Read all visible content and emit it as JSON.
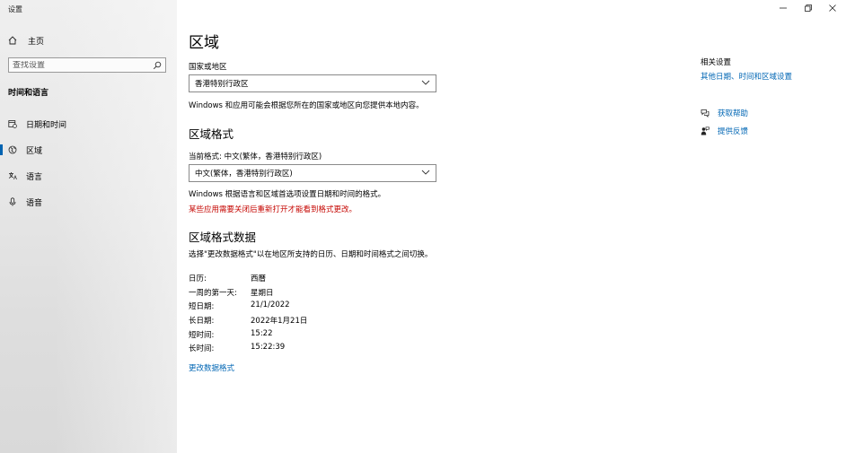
{
  "window": {
    "title": "设置",
    "controls": {
      "minimize": "—",
      "maximize": "⧉",
      "close": "✕"
    }
  },
  "sidebar": {
    "home_label": "主页",
    "search_placeholder": "查找设置",
    "section_label": "时间和语言",
    "items": [
      {
        "label": "日期和时间",
        "icon": "calendar-clock-icon",
        "active": false
      },
      {
        "label": "区域",
        "icon": "globe-region-icon",
        "active": true
      },
      {
        "label": "语言",
        "icon": "language-icon",
        "active": false
      },
      {
        "label": "语音",
        "icon": "microphone-icon",
        "active": false
      }
    ]
  },
  "main": {
    "title": "区域",
    "country": {
      "label": "国家或地区",
      "value": "香港特别行政区",
      "description": "Windows 和应用可能会根据您所在的国家或地区向您提供本地内容。"
    },
    "format": {
      "heading": "区域格式",
      "current_label": "当前格式: 中文(繁体，香港特别行政区)",
      "value": "中文(繁体，香港特别行政区)",
      "description": "Windows 根据语言和区域首选项设置日期和时间的格式。",
      "warning": "某些应用需要关闭后重新打开才能看到格式更改。"
    },
    "data": {
      "heading": "区域格式数据",
      "description": "选择\"更改数据格式\"以在地区所支持的日历、日期和时间格式之间切换。",
      "rows": [
        {
          "key": "日历:",
          "value": "西曆"
        },
        {
          "key": "一周的第一天:",
          "value": "星期日"
        },
        {
          "key": "短日期:",
          "value": "21/1/2022"
        },
        {
          "key": "长日期:",
          "value": "2022年1月21日"
        },
        {
          "key": "短时间:",
          "value": "15:22"
        },
        {
          "key": "长时间:",
          "value": "15:22:39"
        }
      ],
      "change_link": "更改数据格式"
    }
  },
  "related": {
    "title": "相关设置",
    "link": "其他日期、时间和区域设置",
    "help": [
      {
        "label": "获取帮助",
        "icon": "help-chat-icon"
      },
      {
        "label": "提供反馈",
        "icon": "feedback-icon"
      }
    ]
  },
  "colors": {
    "accent": "#0066b4",
    "warning": "#c50500"
  }
}
